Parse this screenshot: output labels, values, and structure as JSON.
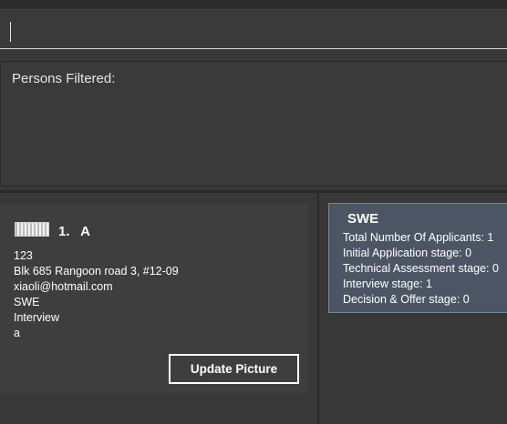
{
  "command_box": {
    "value": ""
  },
  "result_display": {
    "text": "Persons Filtered:"
  },
  "person_list": [
    {
      "index": "1.",
      "name": "A",
      "phone": "123",
      "address": "Blk 685 Rangoon road 3, #12-09",
      "email": "xiaoli@hotmail.com",
      "job": "SWE",
      "stage": "Interview",
      "remark": "a",
      "update_button_label": "Update Picture"
    }
  ],
  "job_stats": [
    {
      "title": "SWE",
      "lines": [
        "Total Number Of Applicants: 1",
        "Initial Application stage: 0",
        "Technical Assessment stage: 0",
        "Interview stage: 1",
        "Decision & Offer stage: 0"
      ]
    }
  ],
  "colors": {
    "background": "#383838",
    "panel": "#3e3e3e",
    "stats_card": "#4c5563",
    "stats_card_border": "#7a8696",
    "text": "#ffffff"
  }
}
